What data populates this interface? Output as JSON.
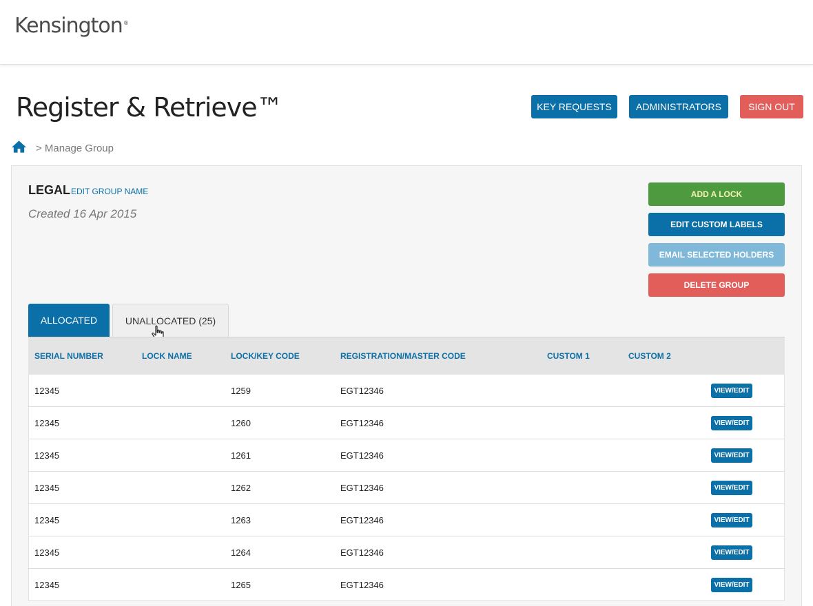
{
  "header": {
    "logo_text": "Kensington",
    "logo_mark": "®"
  },
  "app": {
    "title": "Register & Retrieve™"
  },
  "top_nav": {
    "key_requests": "KEY REQUESTS",
    "administrators": "ADMINISTRATORS",
    "sign_out": "SIGN OUT"
  },
  "breadcrumb": {
    "home_icon": "home-icon",
    "current": "> Manage Group"
  },
  "group": {
    "name": "LEGAL",
    "edit_link": "EDIT GROUP NAME",
    "created": "Created 16 Apr 2015"
  },
  "actions": {
    "add_lock": "ADD A LOCK",
    "edit_labels": "EDIT CUSTOM LABELS",
    "email_holders": "EMAIL SELECTED HOLDERS",
    "delete_group": "DELETE GROUP"
  },
  "tabs": [
    {
      "label": "ALLOCATED",
      "active": true
    },
    {
      "label": "UNALLOCATED (25)",
      "active": false
    }
  ],
  "table": {
    "columns": [
      "SERIAL NUMBER",
      "LOCK NAME",
      "LOCK/KEY CODE",
      "REGISTRATION/MASTER CODE",
      "CUSTOM 1",
      "CUSTOM 2"
    ],
    "rows": [
      {
        "serial": "12345",
        "lock_name": "",
        "code": "1259",
        "registration": "EGT12346",
        "custom1": "",
        "custom2": "",
        "action": "VIEW/EDIT"
      },
      {
        "serial": "12345",
        "lock_name": "",
        "code": "1260",
        "registration": "EGT12346",
        "custom1": "",
        "custom2": "",
        "action": "VIEW/EDIT"
      },
      {
        "serial": "12345",
        "lock_name": "",
        "code": "1261",
        "registration": "EGT12346",
        "custom1": "",
        "custom2": "",
        "action": "VIEW/EDIT"
      },
      {
        "serial": "12345",
        "lock_name": "",
        "code": "1262",
        "registration": "EGT12346",
        "custom1": "",
        "custom2": "",
        "action": "VIEW/EDIT"
      },
      {
        "serial": "12345",
        "lock_name": "",
        "code": "1263",
        "registration": "EGT12346",
        "custom1": "",
        "custom2": "",
        "action": "VIEW/EDIT"
      },
      {
        "serial": "12345",
        "lock_name": "",
        "code": "1264",
        "registration": "EGT12346",
        "custom1": "",
        "custom2": "",
        "action": "VIEW/EDIT"
      },
      {
        "serial": "12345",
        "lock_name": "",
        "code": "1265",
        "registration": "EGT12346",
        "custom1": "",
        "custom2": "",
        "action": "VIEW/EDIT"
      }
    ]
  },
  "colors": {
    "primary_blue": "#0b6fa8",
    "success_green": "#4e9a3e",
    "danger_red": "#e15e5b",
    "light_blue": "#7fb8d8"
  }
}
